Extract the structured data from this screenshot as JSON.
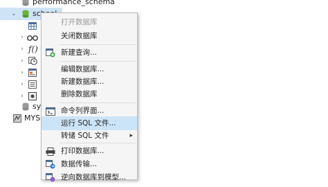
{
  "tree": {
    "performance_schema": "performance_schema",
    "school": "school",
    "sys": "sys",
    "mysql_connection": "MYSQ"
  },
  "context_menu": {
    "items": [
      {
        "label": "打开数据库",
        "disabled": true
      },
      {
        "label": "关闭数据库",
        "disabled": false
      },
      {
        "label": "新建查询...",
        "disabled": false,
        "icon": "new-query-icon"
      },
      {
        "label": "编辑数据库...",
        "disabled": false
      },
      {
        "label": "新建数据库...",
        "disabled": false
      },
      {
        "label": "删除数据库",
        "disabled": false
      },
      {
        "label": "命令列界面...",
        "disabled": false,
        "icon": "console-icon"
      },
      {
        "label": "运行 SQL 文件...",
        "disabled": false,
        "highlighted": true
      },
      {
        "label": "转储 SQL 文件",
        "disabled": false,
        "submenu": true
      },
      {
        "label": "打印数据库...",
        "disabled": false,
        "icon": "printer-icon"
      },
      {
        "label": "数据传输...",
        "disabled": false,
        "icon": "data-transfer-icon"
      },
      {
        "label": "逆向数据库到模型...",
        "disabled": false,
        "icon": "model-icon"
      }
    ]
  },
  "colors": {
    "selection": "#cfe3f7",
    "menu_highlight": "#cce4f7",
    "menu_bg": "#f5f5f5"
  }
}
